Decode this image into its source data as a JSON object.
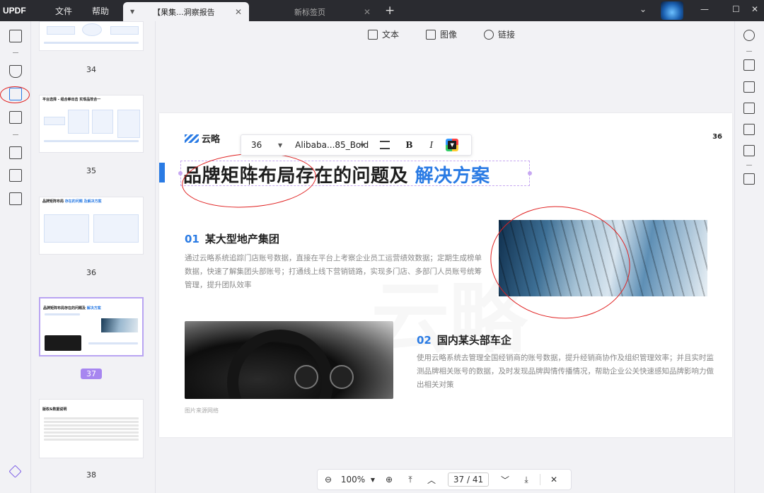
{
  "app": {
    "logo": "UPDF"
  },
  "menu": {
    "file": "文件",
    "help": "帮助"
  },
  "tabs": [
    {
      "label": "【果集...洞察报告",
      "active": true
    },
    {
      "label": "新标签页",
      "active": false
    }
  ],
  "top_tools": {
    "text": "文本",
    "image": "图像",
    "link": "链接"
  },
  "format_bar": {
    "font_size": "36",
    "font_name": "Alibaba...85_Bold",
    "bold": "B",
    "italic": "I"
  },
  "page": {
    "brand": "云略",
    "page_number": "36",
    "heading_main": "品牌矩阵布局存在的问题及",
    "heading_highlight": "解决方案",
    "section1": {
      "num": "01",
      "title": "某大型地产集团",
      "body": "通过云略系统追踪门店账号数据，直接在平台上考察企业员工运营绩效数据；定期生成榜单数据，快速了解集团头部账号；打通线上线下营销链路，实现多门店、多部门人员账号统筹管理，提升团队效率"
    },
    "section2": {
      "num": "02",
      "title": "国内某头部车企",
      "body": "使用云略系统去管理全国经销商的账号数据，提升经销商协作及组织管理效率；并且实时监测品牌相关账号的数据，及时发现品牌舆情传播情况，帮助企业公关快速感知品牌影响力做出相关对策"
    },
    "caption": "图片来源网络"
  },
  "thumbnails": [
    {
      "number": "34"
    },
    {
      "number": "35",
      "title": "平台选择 - 组合拳出击 实现品效合一"
    },
    {
      "number": "36",
      "title": "品牌矩阵布局",
      "title_hl": "存在的问题 及解决方案"
    },
    {
      "number": "37",
      "title": "品牌矩阵布局存在的问题及",
      "title_hl": "解决方案",
      "selected": true
    },
    {
      "number": "38",
      "title": "版权&数据说明"
    }
  ],
  "bottom_nav": {
    "zoom": "100%",
    "current_page": "37",
    "total_pages": "41",
    "separator": "/"
  },
  "colors": {
    "accent": "#2a7be4",
    "selection": "#a786f0",
    "annotation": "#e02020"
  }
}
